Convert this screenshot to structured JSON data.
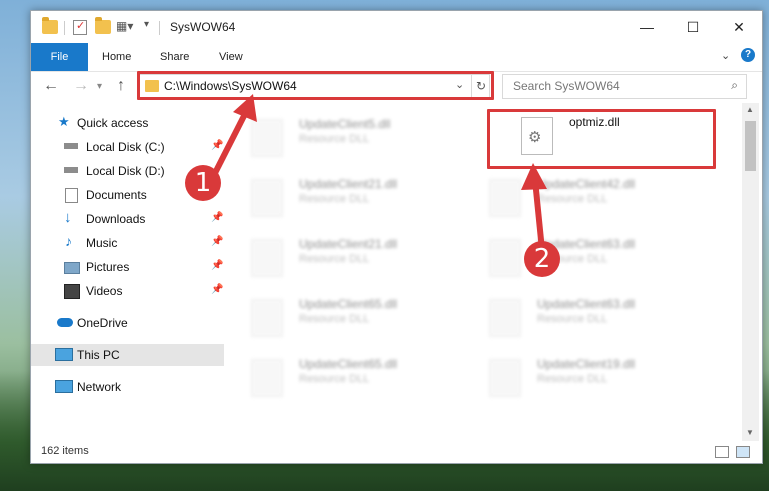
{
  "window": {
    "title": "SysWOW64",
    "controls": {
      "minimize": "—",
      "maximize": "☐",
      "close": "✕"
    }
  },
  "ribbon": {
    "tabs": [
      "File",
      "Home",
      "Share",
      "View"
    ],
    "help": "?"
  },
  "navigation": {
    "back": "←",
    "forward": "→",
    "up": "↑",
    "address": "C:\\Windows\\SysWOW64",
    "search_placeholder": "Search SysWOW64"
  },
  "sidebar": {
    "items": [
      {
        "label": "Quick access",
        "icon": "star-icon"
      },
      {
        "label": "Local Disk (C:)",
        "icon": "drive-icon",
        "pinned": true
      },
      {
        "label": "Local Disk (D:)",
        "icon": "drive-icon"
      },
      {
        "label": "Documents",
        "icon": "documents-icon"
      },
      {
        "label": "Downloads",
        "icon": "download-icon",
        "pinned": true
      },
      {
        "label": "Music",
        "icon": "music-icon",
        "pinned": true
      },
      {
        "label": "Pictures",
        "icon": "pictures-icon",
        "pinned": true
      },
      {
        "label": "Videos",
        "icon": "videos-icon",
        "pinned": true
      },
      {
        "label": "OneDrive",
        "icon": "cloud-icon"
      },
      {
        "label": "This PC",
        "icon": "computer-icon",
        "selected": true
      },
      {
        "label": "Network",
        "icon": "network-icon"
      }
    ]
  },
  "files": {
    "left": [
      {
        "name": "UpdateClient5.dll",
        "type": "Resource DLL"
      },
      {
        "name": "UpdateClient21.dll",
        "type": "Resource DLL"
      },
      {
        "name": "UpdateClient21.dll",
        "type": "Resource DLL"
      },
      {
        "name": "UpdateClient65.dll",
        "type": "Resource DLL"
      },
      {
        "name": "UpdateClient65.dll",
        "type": "Resource DLL"
      }
    ],
    "right": [
      {
        "name": "optmiz.dll",
        "type": ""
      },
      {
        "name": "UpdateClient42.dll",
        "type": "Resource DLL"
      },
      {
        "name": "UpdateClient63.dll",
        "type": "Resource DLL"
      },
      {
        "name": "UpdateClient63.dll",
        "type": "Resource DLL"
      },
      {
        "name": "UpdateClient19.dll",
        "type": "Resource DLL"
      }
    ]
  },
  "status": {
    "item_count": "162 items"
  },
  "annotations": {
    "step1": "1",
    "step2": "2",
    "color": "#d9393a"
  }
}
